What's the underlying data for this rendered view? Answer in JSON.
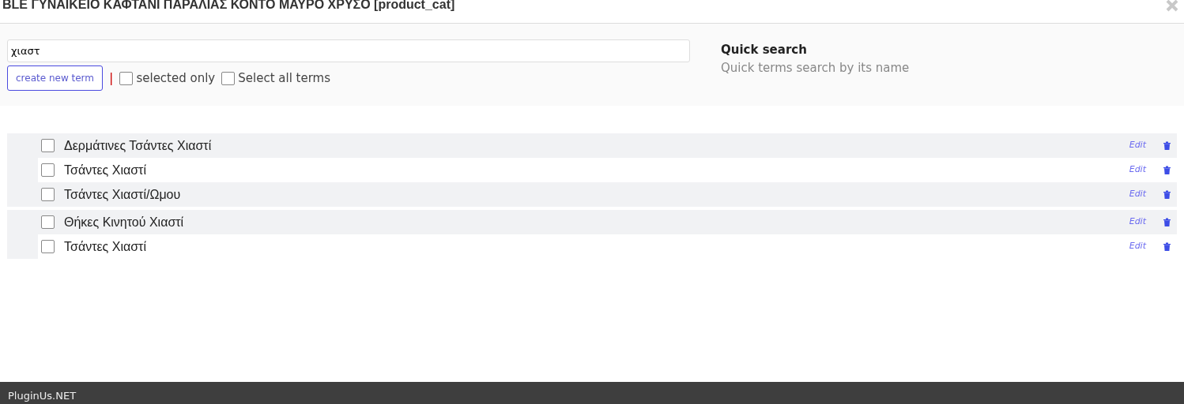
{
  "window": {
    "title": "BLE ΓΥΝΑΙΚΕΙΟ ΚΑΦΤΑΝΙ ΠΑΡΑΛΙΑΣ ΚΟΝΤΟ ΜΑΥΡΟ ΧΡΥΣΟ [product_cat]"
  },
  "search": {
    "value": "χιαστ"
  },
  "create_button": "create new term",
  "separator": "|",
  "options": [
    {
      "label": "selected only",
      "checked": false
    },
    {
      "label": "Select all terms",
      "checked": false
    }
  ],
  "help": {
    "title": "Quick search",
    "text": "Quick terms search by its name"
  },
  "groups": [
    {
      "terms": [
        {
          "name": "Δερμάτινες Τσάντες Χιαστί",
          "checked": false,
          "edit": "Edit"
        },
        {
          "name": "Τσάντες Χιαστί",
          "checked": false,
          "edit": "Edit"
        },
        {
          "name": "Τσάντες Χιαστί/Ωμου",
          "checked": false,
          "edit": "Edit"
        }
      ]
    },
    {
      "terms": [
        {
          "name": "Θήκες Κινητού Χιαστί",
          "checked": false,
          "edit": "Edit"
        },
        {
          "name": "Τσάντες Χιαστί",
          "checked": false,
          "edit": "Edit"
        }
      ]
    }
  ],
  "footer": "PluginUs.NET"
}
